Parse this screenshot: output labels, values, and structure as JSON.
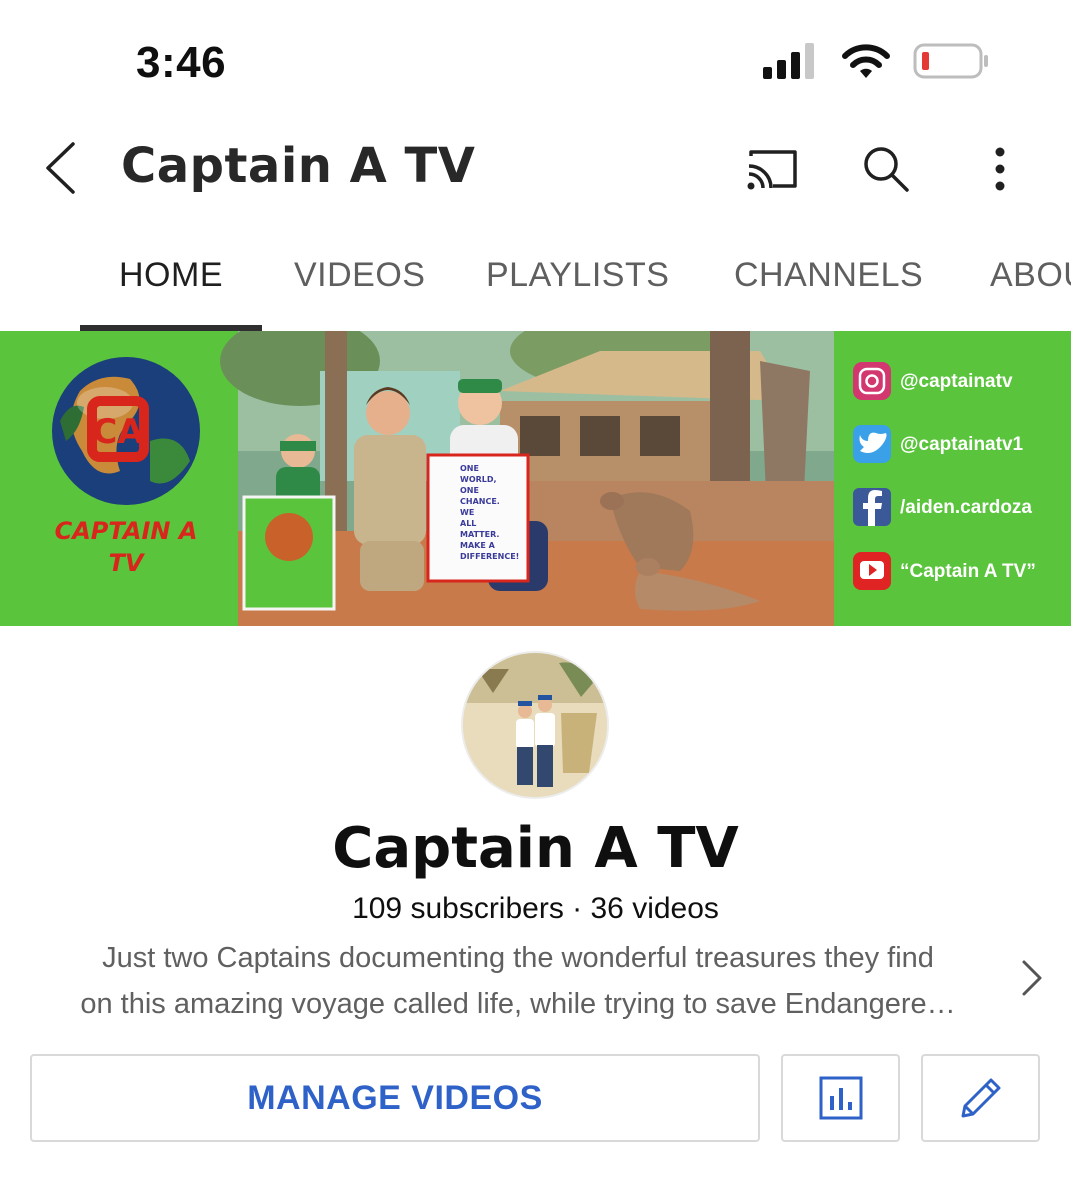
{
  "status_bar": {
    "time": "3:46",
    "icons": [
      "signal-icon",
      "wifi-icon",
      "battery-low-icon"
    ]
  },
  "header": {
    "title": "Captain A TV",
    "actions": [
      "cast-icon",
      "search-icon",
      "more-vert-icon"
    ]
  },
  "tabs": [
    {
      "label": "HOME",
      "active": true
    },
    {
      "label": "VIDEOS",
      "active": false
    },
    {
      "label": "PLAYLISTS",
      "active": false
    },
    {
      "label": "CHANNELS",
      "active": false
    },
    {
      "label": "ABOUT",
      "active": false
    }
  ],
  "banner": {
    "logo_text": [
      "CAPTAIN A",
      "TV"
    ],
    "sign_text": [
      "ONE",
      "WORLD,",
      "ONE",
      "CHANCE.",
      "WE",
      "ALL",
      "MATTER.",
      "MAKE A",
      "DIFFERENCE!"
    ],
    "socials": [
      {
        "icon": "instagram-icon",
        "handle": "@captainatv"
      },
      {
        "icon": "twitter-icon",
        "handle": "@captainatv1"
      },
      {
        "icon": "facebook-icon",
        "handle": "/aiden.cardoza"
      },
      {
        "icon": "youtube-icon",
        "handle": "“Captain A TV”"
      }
    ]
  },
  "channel": {
    "name": "Captain A TV",
    "stats": "109 subscribers · 36 videos",
    "description_line1": "Just two Captains documenting the wonderful treasures they find",
    "description_line2": "on this amazing voyage called life, while trying to save Endangere…"
  },
  "buttons": {
    "manage_videos": "MANAGE VIDEOS",
    "analytics_icon": "analytics-icon",
    "edit_icon": "pencil-icon"
  },
  "colors": {
    "banner_green": "#5ac43c",
    "button_blue": "#2f62c8",
    "battery_red": "#e53935"
  }
}
